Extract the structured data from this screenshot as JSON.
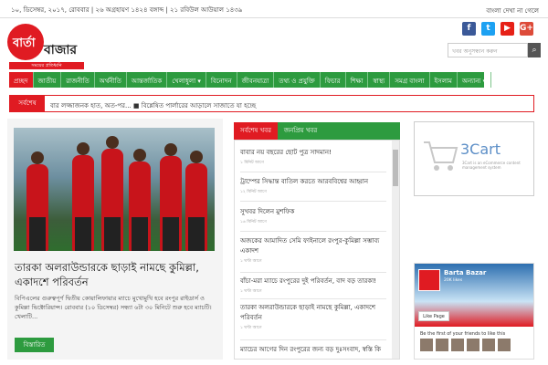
{
  "topbar": {
    "date": "১০, ডিসেম্বর, ২০১৭, রোববার | ২৬ অগ্রহায়ণ ১৪২৪ বঙ্গাব্দ | ২১ রবিউল আউয়াল ১৪৩৯",
    "show_bangla": "বাংলা দেখা না গেলে"
  },
  "logo": {
    "brand_first": "বার্তা",
    "brand_second": "বাজার",
    "tagline": "সময়ের প্রতিধ্বনি"
  },
  "social": [
    {
      "icon": "facebook-icon",
      "glyph": "f",
      "color": "#3b5998"
    },
    {
      "icon": "twitter-icon",
      "glyph": "t",
      "color": "#1da1f2"
    },
    {
      "icon": "youtube-icon",
      "glyph": "▶",
      "color": "#e62117"
    },
    {
      "icon": "google-plus-icon",
      "glyph": "G+",
      "color": "#dd4b39"
    }
  ],
  "search": {
    "placeholder": "খবর অনুসন্ধান করুন"
  },
  "nav": [
    "প্রচ্ছদ",
    "জাতীয়",
    "রাজনীতি",
    "অর্থনীতি",
    "আন্তর্জাতিক",
    "খেলাধুলা ▾",
    "বিনোদন",
    "জীবনযাত্রা",
    "তথ্য ও প্রযুক্তি",
    "ফিচার",
    "শিক্ষা",
    "স্বাস্থ্য",
    "সমগ্র বাংলা",
    "ইসলাম",
    "অন্যান্য ▾"
  ],
  "ticker": {
    "label": "সর্বশেষ",
    "text": "বার লজ্জাজনক হাত, অত-পর...     ■  বিশ্লেষিত পার্লারের আড়ালে সাজাতে যা হচ্ছে"
  },
  "lead": {
    "headline": "তারকা অলরাউন্ডারকে ছাড়াই নামছে কুমিল্লা, একাদশে পরিবর্তন",
    "summary": "বিপিএলের গুরুত্বপূর্ণ দ্বিতীয় কোয়ালিফায়ার ম্যাচে মুখোমুখি হবে রংপুর রাইডার্স ও কুমিল্লা ভিক্টোরিয়ান্স। রোববার (১০ ডিসেম্বর) সন্ধ্যা ৬টা ৩০ মিনিটে শুরু হবে ম্যাচটি। খেলাটি...",
    "button": "বিস্তারিত"
  },
  "tabs": {
    "latest": "সর্বশেষ খবর",
    "popular": "জনপ্রিয় খবর"
  },
  "news": [
    {
      "title": "বাবার নয় বছরের ছোট পুত্র সাদমান!",
      "time": "১ মিনিট আগে"
    },
    {
      "title": "ট্রাম্পের সিদ্ধান্ত বাতিল করতে আরববিশ্বের আহ্বান",
      "time": "১২ মিনিট আগে"
    },
    {
      "title": "সুখবর দিলেন মুশফিক",
      "time": "১৬ মিনিট আগে"
    },
    {
      "title": "অজকের আমাদিত সেমি ফাইনালে রংপুর-কুমিল্লা সম্ভাব্য একাদশ",
      "time": "১ ঘণ্টা আগে"
    },
    {
      "title": "বাঁচা-মরা ম্যাচে রংপুরের দুই পরিবর্তন, বাদ বড় তারকা!",
      "time": "১ ঘণ্টা আগে"
    },
    {
      "title": "তারকা অলরাউন্ডারকে ছাড়াই নামছে কুমিল্লা, একাদশে পরিবর্তন",
      "time": "১ ঘণ্টা আগে"
    },
    {
      "title": "ম্যাচের আগের দিন রংপুরের জন্য বড় দুঃসংবাদ, স্বস্তি কি",
      "time": ""
    }
  ],
  "ad": {
    "brand": "3Cart",
    "sub": "3Cart is an eCommerce content management system"
  },
  "fb": {
    "name": "Barta Bazar",
    "likes": "20K likes",
    "like_button": "Like Page",
    "friends": "Be the first of your friends to like this"
  }
}
